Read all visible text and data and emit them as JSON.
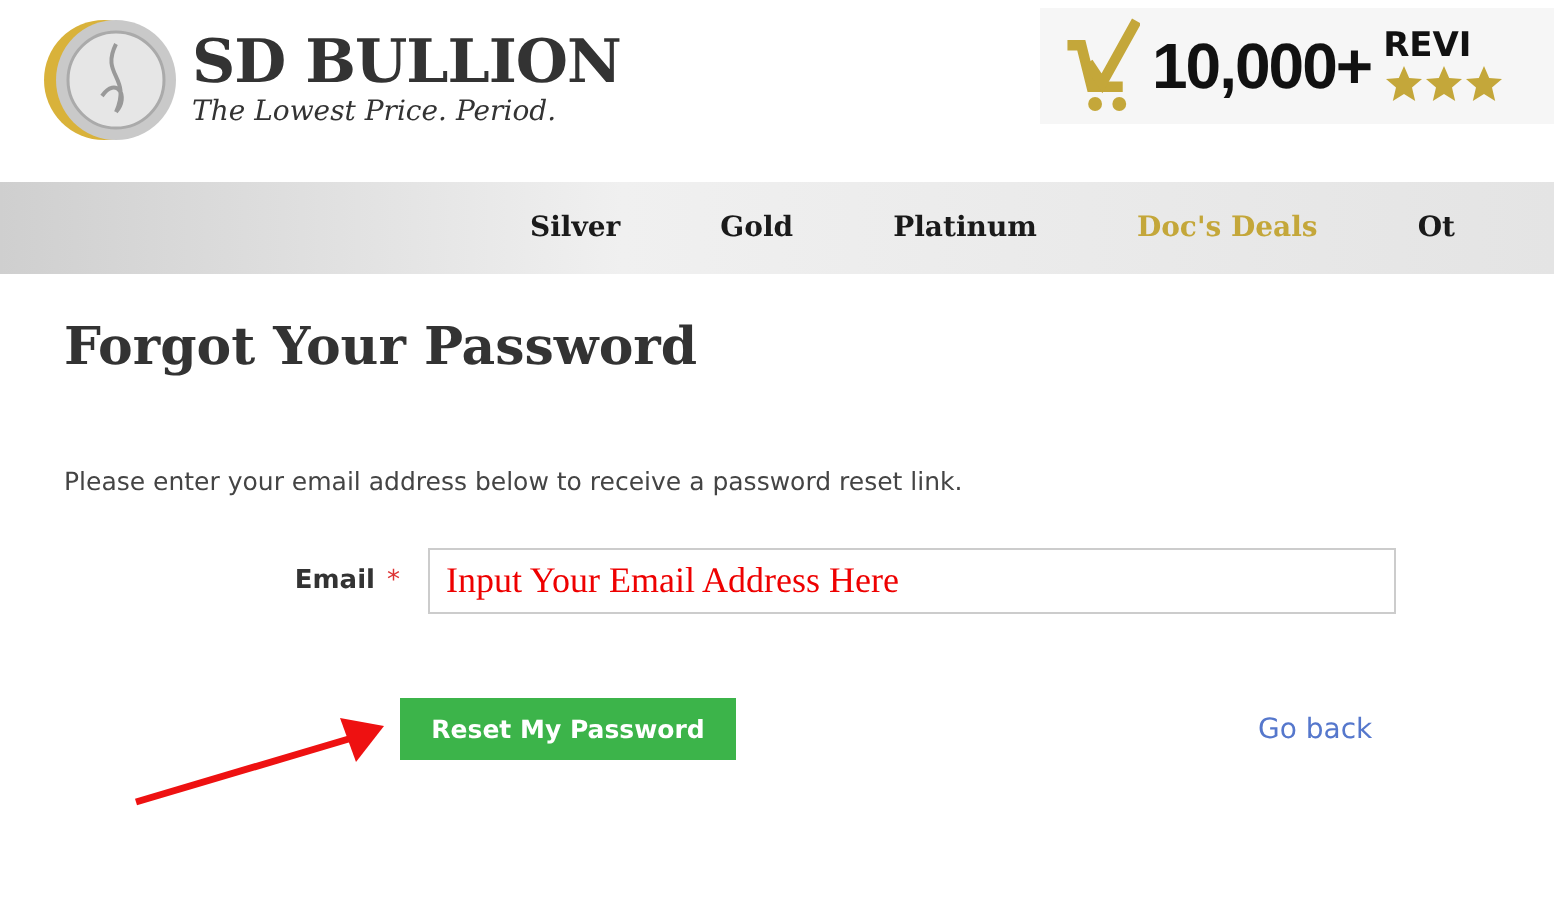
{
  "logo": {
    "name": "SD BULLION",
    "tagline": "The Lowest Price. Period."
  },
  "reviews_banner": {
    "count": "10,000+",
    "label": "REVI",
    "stars": 3
  },
  "nav": [
    {
      "label": "Silver",
      "color": "#1a1a1a"
    },
    {
      "label": "Gold",
      "color": "#1a1a1a"
    },
    {
      "label": "Platinum",
      "color": "#1a1a1a"
    },
    {
      "label": "Doc's Deals",
      "color": "#c4a73a"
    },
    {
      "label": "Ot",
      "color": "#1a1a1a"
    }
  ],
  "title": "Forgot Your Password",
  "instructions": "Please enter your email address below to receive a password reset link.",
  "email": {
    "label": "Email",
    "required_mark": "*",
    "value": "Input Your Email Address Here"
  },
  "submit_button": "Reset My Password",
  "back_link": "Go back",
  "annotation_arrow": true
}
